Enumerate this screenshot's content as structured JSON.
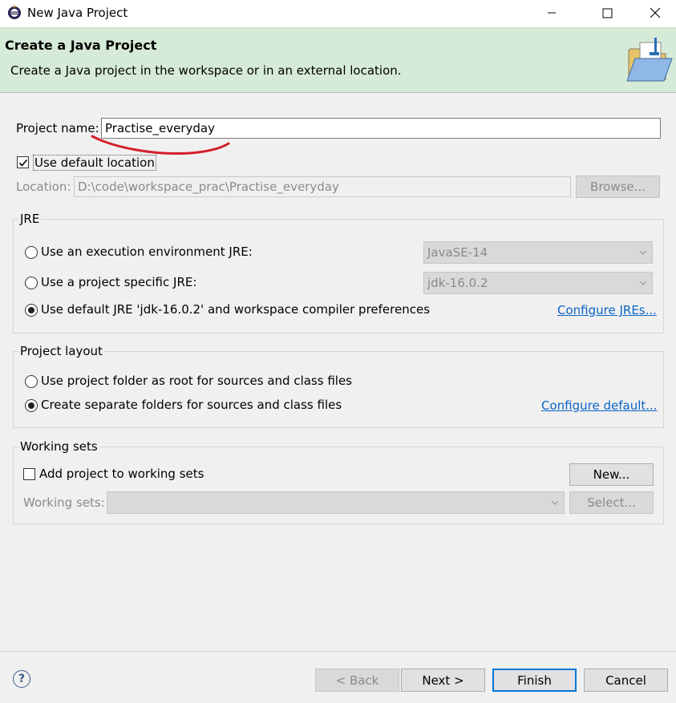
{
  "window": {
    "title": "New Java Project",
    "buttons": [
      "minimize",
      "maximize",
      "close"
    ]
  },
  "banner": {
    "title": "Create a Java Project",
    "description": "Create a Java project in the workspace or in an external location."
  },
  "project": {
    "name_label": "Project name:",
    "name_value": "Practise_everyday",
    "use_default_location_label": "Use default location",
    "use_default_location_checked": true,
    "location_label": "Location:",
    "location_value": "D:\\code\\workspace_prac\\Practise_everyday",
    "browse_label": "Browse..."
  },
  "jre": {
    "group_title": "JRE",
    "option_env_label": "Use an execution environment JRE:",
    "option_env_value": "JavaSE-14",
    "option_specific_label": "Use a project specific JRE:",
    "option_specific_value": "jdk-16.0.2",
    "option_default_label": "Use default JRE 'jdk-16.0.2' and workspace compiler preferences",
    "selected": "default",
    "configure_link": "Configure JREs..."
  },
  "layout": {
    "group_title": "Project layout",
    "option_root_label": "Use project folder as root for sources and class files",
    "option_separate_label": "Create separate folders for sources and class files",
    "selected": "separate",
    "configure_link": "Configure default..."
  },
  "working_sets": {
    "group_title": "Working sets",
    "add_label": "Add project to working sets",
    "add_checked": false,
    "new_label": "New...",
    "sets_label": "Working sets:",
    "select_label": "Select..."
  },
  "footer": {
    "back_label": "< Back",
    "next_label": "Next >",
    "finish_label": "Finish",
    "cancel_label": "Cancel"
  },
  "colors": {
    "banner_bg": "#d6ebd7",
    "annotation_red": "#d41f2a",
    "link": "#0b63c6",
    "default_button_border": "#0078d7"
  },
  "icons": [
    "eclipse-app-icon",
    "minimize-icon",
    "maximize-icon",
    "close-icon",
    "java-project-folder-icon",
    "help-icon",
    "dropdown-arrow-icon"
  ]
}
